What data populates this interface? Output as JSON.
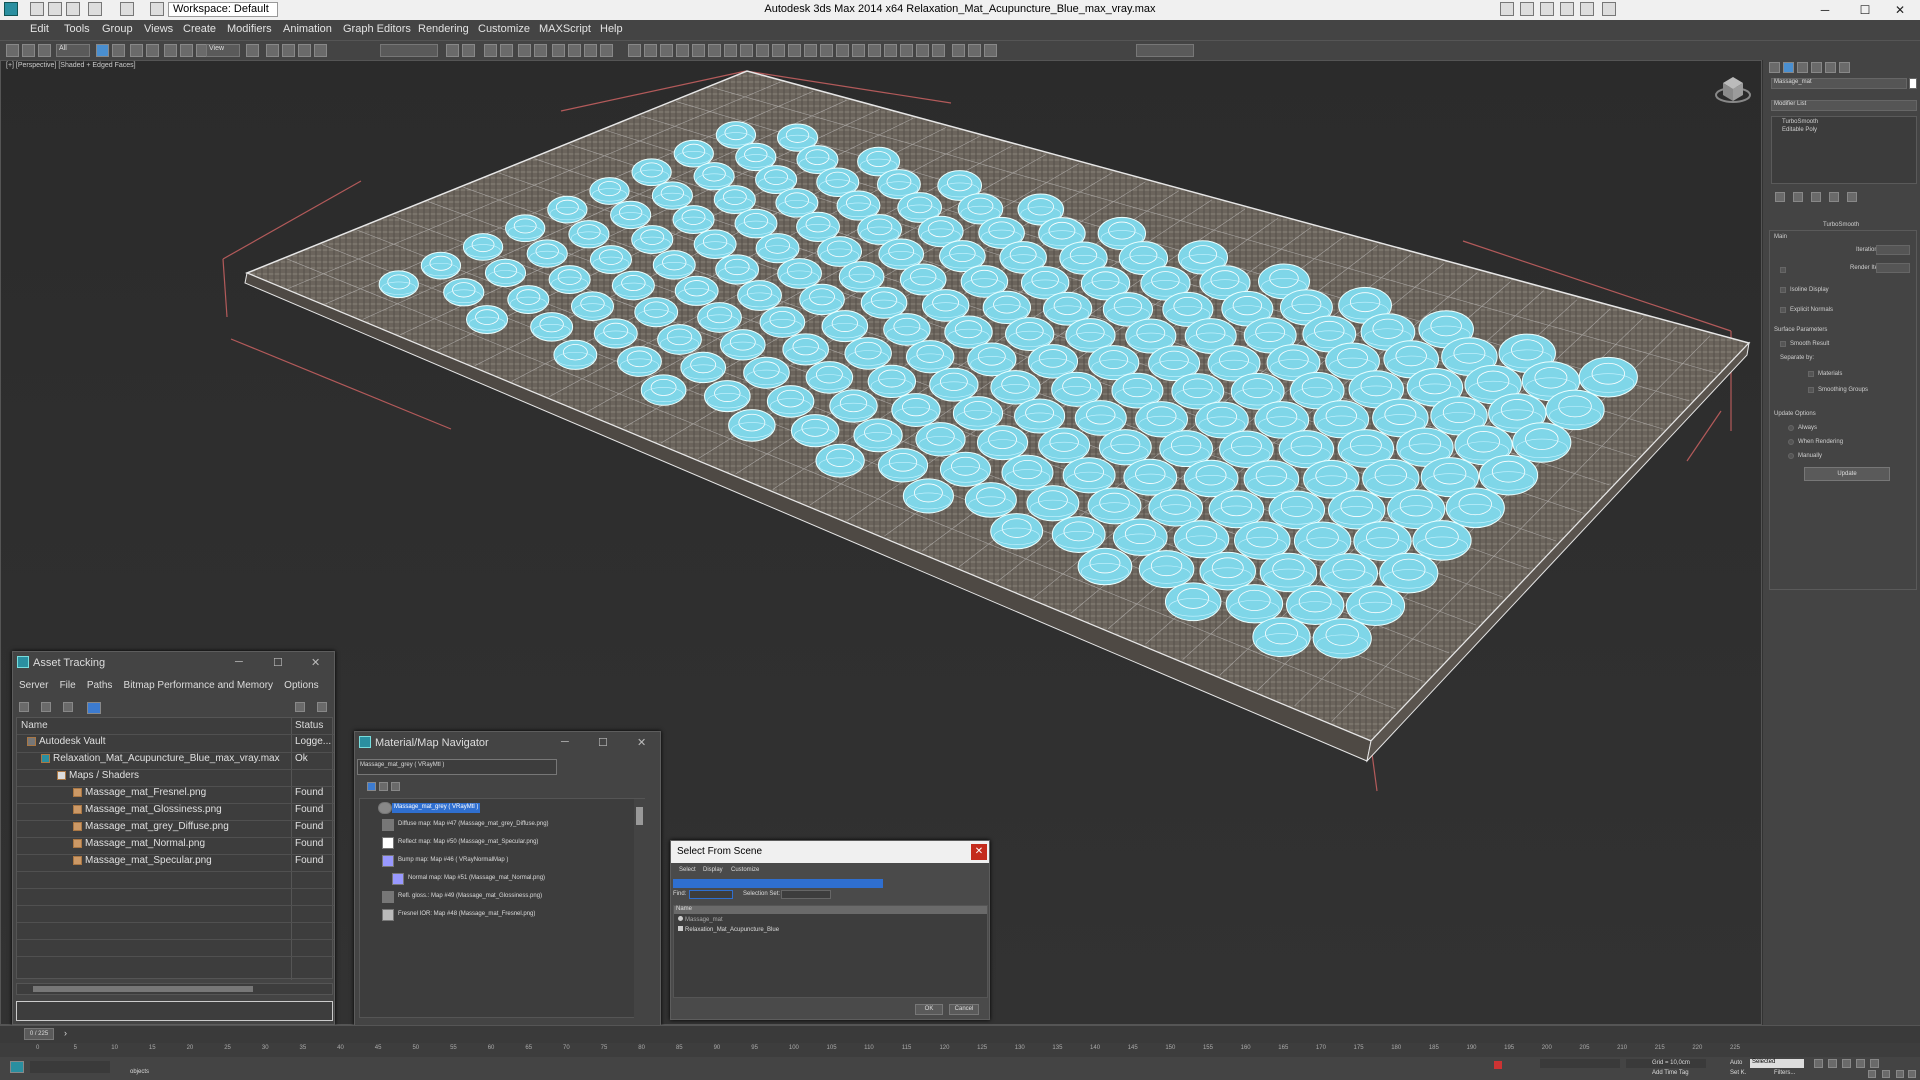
{
  "titlebar": {
    "workspace": "Workspace: Default",
    "title": "Autodesk 3ds Max  2014 x64     Relaxation_Mat_Acupuncture_Blue_max_vray.max"
  },
  "menu": [
    "Edit",
    "Tools",
    "Group",
    "Views",
    "Create",
    "Modifiers",
    "Animation",
    "Graph Editors",
    "Rendering",
    "Customize",
    "MAXScript",
    "Help"
  ],
  "toolbar": {
    "filter": "All",
    "refcoord": "View"
  },
  "viewport": {
    "label": "[+] [Perspective] [Shaded + Edged Faces]"
  },
  "command_panel": {
    "object_name": "Massage_mat",
    "modifier_list": "Modifier List",
    "stack": [
      "TurboSmooth",
      "Editable Poly"
    ],
    "rollout": "TurboSmooth",
    "main": "Main",
    "iterations": "Iterations:",
    "render_iters": "Render Iters:",
    "isoline": "Isoline Display",
    "explicit": "Explicit Normals",
    "surface": "Surface Parameters",
    "smooth_result": "Smooth Result",
    "separate_by": "Separate by:",
    "materials": "Materials",
    "smoothing_groups": "Smoothing Groups",
    "update_options": "Update Options",
    "always": "Always",
    "when_rendering": "When Rendering",
    "manually": "Manually",
    "update": "Update"
  },
  "asset_tracking": {
    "title": "Asset Tracking",
    "menu": [
      "Server",
      "File",
      "Paths",
      "Bitmap Performance and Memory",
      "Options"
    ],
    "col_name": "Name",
    "col_status": "Status",
    "rows": [
      {
        "name": "Autodesk Vault",
        "status": "Logge..."
      },
      {
        "name": "Relaxation_Mat_Acupuncture_Blue_max_vray.max",
        "status": "Ok"
      },
      {
        "name": "Maps / Shaders",
        "status": ""
      },
      {
        "name": "Massage_mat_Fresnel.png",
        "status": "Found"
      },
      {
        "name": "Massage_mat_Glossiness.png",
        "status": "Found"
      },
      {
        "name": "Massage_mat_grey_Diffuse.png",
        "status": "Found"
      },
      {
        "name": "Massage_mat_Normal.png",
        "status": "Found"
      },
      {
        "name": "Massage_mat_Specular.png",
        "status": "Found"
      }
    ]
  },
  "material_navigator": {
    "title": "Material/Map Navigator",
    "current": "Massage_mat_grey ( VRayMtl )",
    "tree": [
      "Massage_mat_grey ( VRayMtl )",
      "Diffuse map: Map #47 (Massage_mat_grey_Diffuse.png)",
      "Reflect map: Map #50 (Massage_mat_Specular.png)",
      "Bump map: Map #46 ( VRayNormalMap )",
      "Normal map: Map #51 (Massage_mat_Normal.png)",
      "Refl. gloss.: Map #49 (Massage_mat_Glossiness.png)",
      "Fresnel IOR: Map #48 (Massage_mat_Fresnel.png)"
    ]
  },
  "select_from_scene": {
    "title": "Select From Scene",
    "menu": [
      "Select",
      "Display",
      "Customize"
    ],
    "find": "Find:",
    "selection_set": "Selection Set:",
    "col_name": "Name",
    "items": [
      "Massage_mat",
      "Relaxation_Mat_Acupuncture_Blue"
    ],
    "ok": "OK",
    "cancel": "Cancel"
  },
  "timeline": {
    "frame": "0 / 225",
    "ticks": [
      "0",
      "5",
      "10",
      "15",
      "20",
      "25",
      "30",
      "35",
      "40",
      "45",
      "50",
      "55",
      "60",
      "65",
      "70",
      "75",
      "80",
      "85",
      "90",
      "95",
      "100",
      "105",
      "110",
      "115",
      "120",
      "125",
      "130",
      "135",
      "140",
      "145",
      "150",
      "155",
      "160",
      "165",
      "170",
      "175",
      "180",
      "185",
      "190",
      "195",
      "200",
      "205",
      "210",
      "215",
      "220",
      "225"
    ]
  },
  "status": {
    "objects": "objects",
    "grid": "Grid = 10,0cm",
    "autokey": "Auto",
    "selected": "Selected",
    "setkey": "Set K.",
    "filters": "Filters...",
    "addtimetag": "Add Time Tag"
  },
  "colors": {
    "nodule": "#7fd6e8",
    "mat": "#6e6760",
    "wire": "#e6e6e6",
    "bbox": "#b35a5a",
    "ui_bg": "#444444"
  }
}
